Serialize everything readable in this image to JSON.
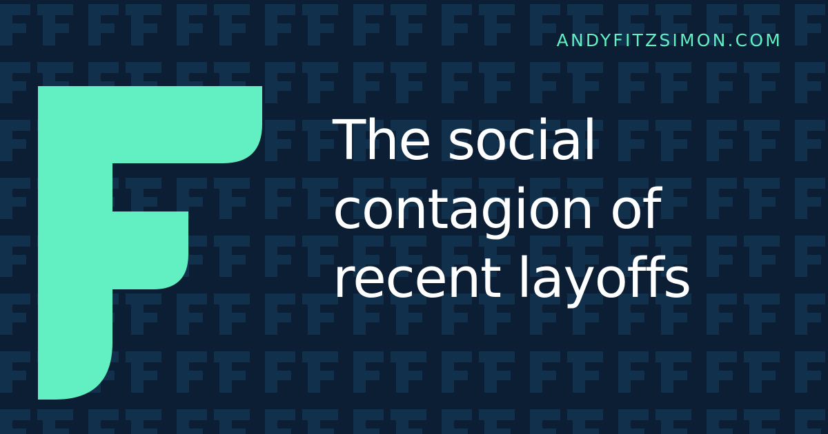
{
  "site": {
    "domain": "ANDYFITZSIMON.COM"
  },
  "headline": {
    "lines": [
      "The social",
      "contagion of",
      "recent layoffs"
    ]
  },
  "logo": {
    "icon": "f-logo-icon"
  },
  "background": {
    "icon": "f-pattern"
  },
  "colors": {
    "background": "#0b1e33",
    "pattern": "#10304b",
    "accent": "#62f0c2",
    "text": "#ffffff"
  }
}
